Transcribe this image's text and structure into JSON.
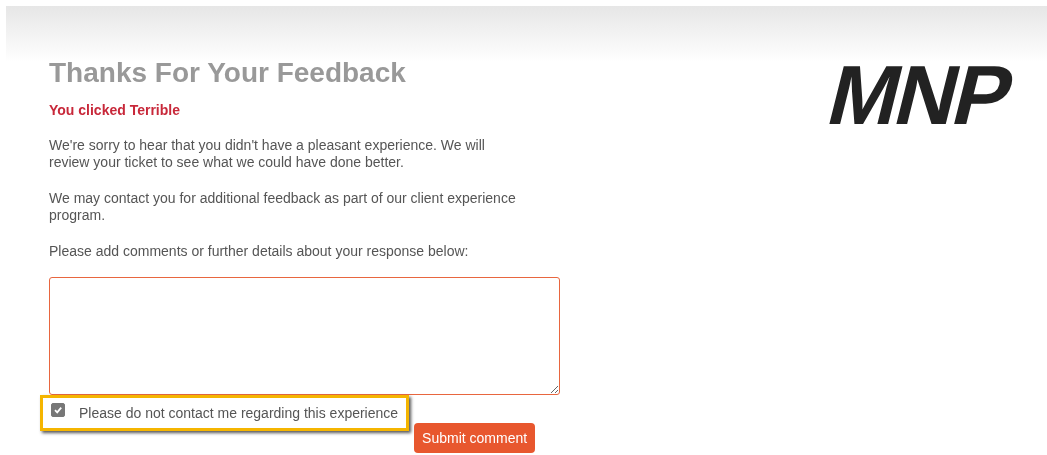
{
  "logo": "MNP",
  "title": "Thanks For Your Feedback",
  "clicked": "You clicked Terrible",
  "paragraphs": [
    "We're sorry to hear that you didn't have a pleasant experience. We will review your ticket to see what we could have done better.",
    "We may contact you for additional feedback as part of our client experience program.",
    "Please add comments or further details about your response below:"
  ],
  "no_contact": {
    "label": "Please do not contact me regarding this experience",
    "checked": true,
    "highlighted": true
  },
  "submit": "Submit comment"
}
